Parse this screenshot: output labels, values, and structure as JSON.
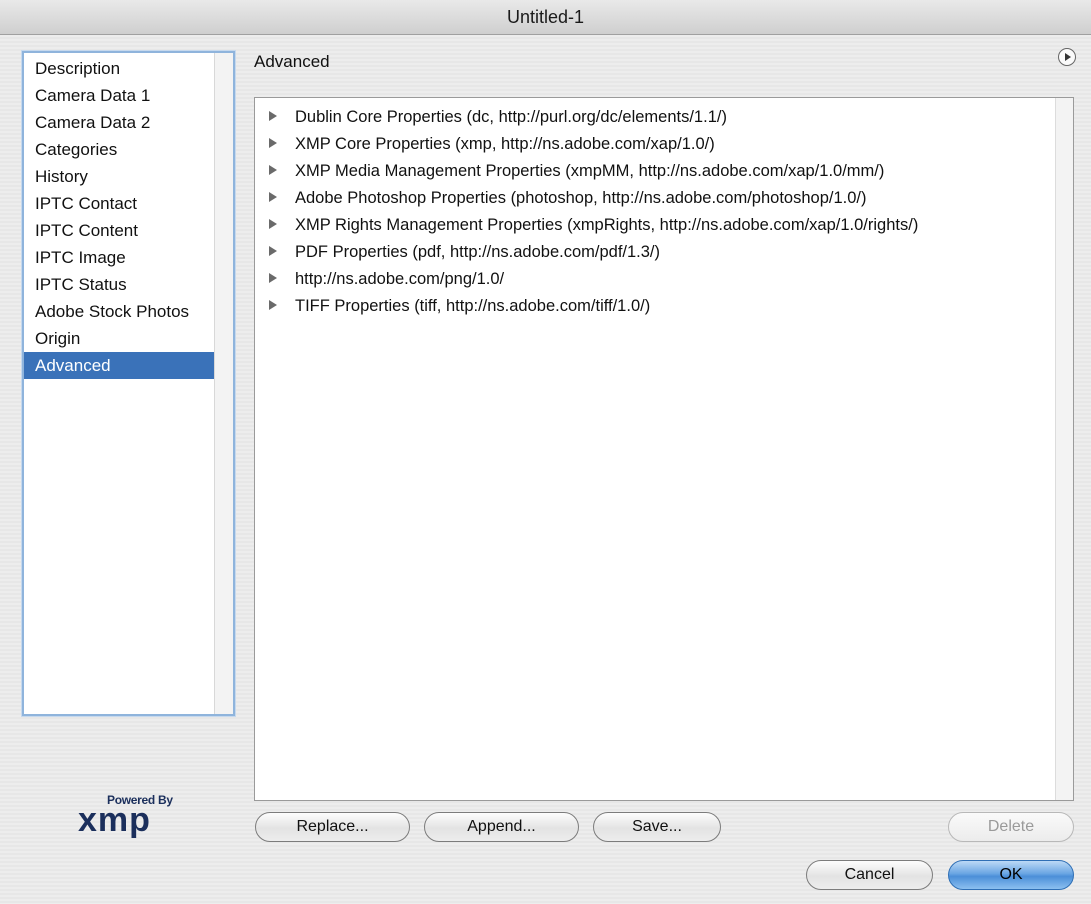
{
  "window": {
    "title": "Untitled-1"
  },
  "sidebar": {
    "items": [
      {
        "label": "Description"
      },
      {
        "label": "Camera Data 1"
      },
      {
        "label": "Camera Data 2"
      },
      {
        "label": "Categories"
      },
      {
        "label": "History"
      },
      {
        "label": "IPTC Contact"
      },
      {
        "label": "IPTC Content"
      },
      {
        "label": "IPTC Image"
      },
      {
        "label": "IPTC Status"
      },
      {
        "label": "Adobe Stock Photos"
      },
      {
        "label": "Origin"
      },
      {
        "label": "Advanced",
        "selected": true
      }
    ]
  },
  "panel": {
    "title": "Advanced",
    "menu_icon": "panel-menu-icon"
  },
  "tree": {
    "rows": [
      {
        "label": "Dublin Core Properties (dc, http://purl.org/dc/elements/1.1/)"
      },
      {
        "label": "XMP Core Properties (xmp, http://ns.adobe.com/xap/1.0/)"
      },
      {
        "label": "XMP Media Management Properties (xmpMM, http://ns.adobe.com/xap/1.0/mm/)"
      },
      {
        "label": "Adobe Photoshop Properties (photoshop, http://ns.adobe.com/photoshop/1.0/)"
      },
      {
        "label": "XMP Rights Management Properties (xmpRights, http://ns.adobe.com/xap/1.0/rights/)"
      },
      {
        "label": "PDF Properties (pdf, http://ns.adobe.com/pdf/1.3/)"
      },
      {
        "label": "http://ns.adobe.com/png/1.0/"
      },
      {
        "label": "TIFF Properties (tiff, http://ns.adobe.com/tiff/1.0/)"
      }
    ]
  },
  "buttons": {
    "replace": "Replace...",
    "append": "Append...",
    "save": "Save...",
    "delete": "Delete",
    "cancel": "Cancel",
    "ok": "OK"
  },
  "logo": {
    "small": "Powered By",
    "big": "xmp"
  },
  "colors": {
    "selection": "#3a72b9",
    "default_button": "#4b8fd8"
  }
}
